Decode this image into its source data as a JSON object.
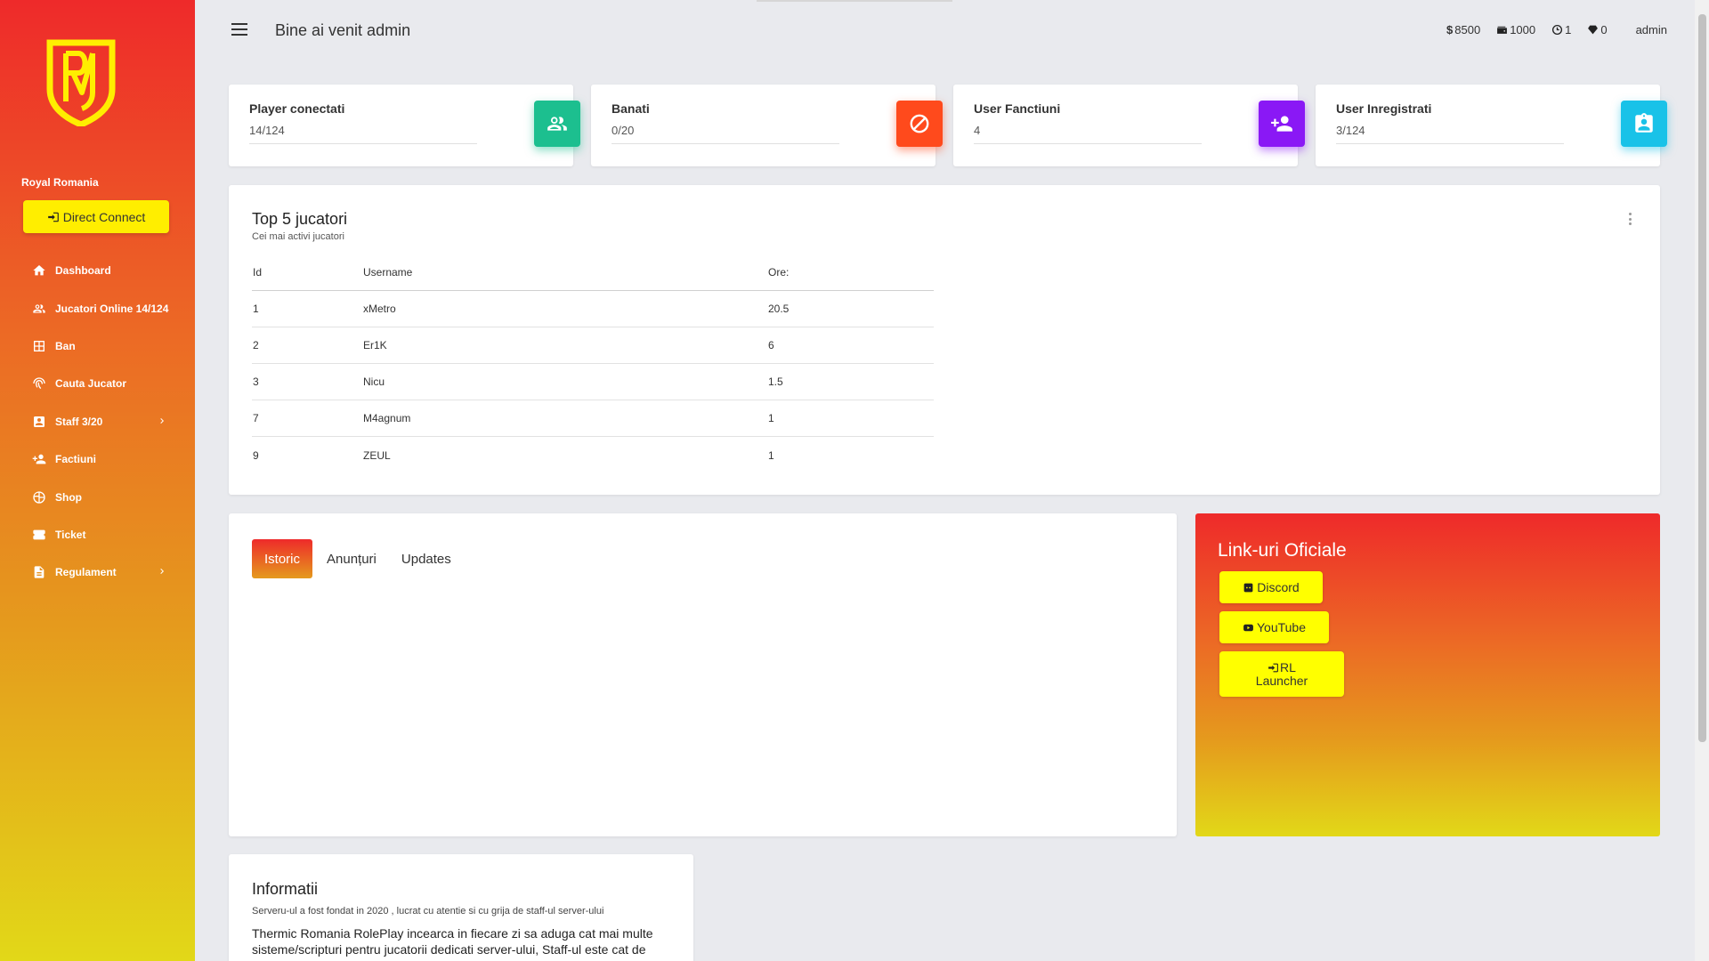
{
  "sidebar": {
    "brand": "Royal Romania",
    "direct_connect": "Direct Connect",
    "items": [
      {
        "label": "Dashboard",
        "icon": "home-icon"
      },
      {
        "label": "Jucatori Online 14/124",
        "icon": "people-icon"
      },
      {
        "label": "Ban",
        "icon": "grid-icon"
      },
      {
        "label": "Cauta Jucator",
        "icon": "fingerprint-icon"
      },
      {
        "label": "Staff 3/20",
        "icon": "badge-icon"
      },
      {
        "label": "Factiuni",
        "icon": "person-add-icon"
      },
      {
        "label": "Shop",
        "icon": "globe-icon"
      },
      {
        "label": "Ticket",
        "icon": "ticket-icon"
      },
      {
        "label": "Regulament",
        "icon": "document-icon"
      }
    ]
  },
  "header": {
    "welcome": "Bine ai venit admin",
    "stats": {
      "money": "8500",
      "cards": "1000",
      "time": "1",
      "diamonds": "0"
    },
    "user": "admin"
  },
  "cards": [
    {
      "title": "Player conectati",
      "value": "14/124",
      "icon": "people-icon",
      "color": "#1cbf8f"
    },
    {
      "title": "Banati",
      "value": "0/20",
      "icon": "block-icon",
      "color": "#ff4a1c"
    },
    {
      "title": "User Fanctiuni",
      "value": "4",
      "icon": "person-add-icon",
      "color": "#8a18f5"
    },
    {
      "title": "User Inregistrati",
      "value": "3/124",
      "icon": "badge-icon",
      "color": "#19c2e8"
    }
  ],
  "top5": {
    "title": "Top 5 jucatori",
    "subtitle": "Cei mai activi jucatori",
    "columns": [
      "Id",
      "Username",
      "Ore:"
    ],
    "rows": [
      [
        "1",
        "xMetro",
        "20.5"
      ],
      [
        "2",
        "Er1K",
        "6"
      ],
      [
        "3",
        "Nicu",
        "1.5"
      ],
      [
        "7",
        "M4agnum",
        "1"
      ],
      [
        "9",
        "ZEUL",
        "1"
      ]
    ]
  },
  "tabs": [
    "Istoric",
    "Anunțuri",
    "Updates"
  ],
  "links": {
    "title": "Link-uri Oficiale",
    "discord": "Discord",
    "youtube": "YouTube",
    "launcher_1": "RL",
    "launcher_2": "Launcher"
  },
  "info": {
    "title": "Informatii",
    "subtitle": "Serveru-ul a fost fondat in 2020 , lucrat cu atentie si cu grija de staff-ul server-ului",
    "body": "Thermic Romania RolePlay incearca in fiecare zi sa aduga cat mai multe sisteme/scripturi pentru jucatorii dedicati server-ului, Staff-ul este cat de"
  },
  "colors": {
    "accent_yellow": "#ffee00",
    "gradient_top": "#ee2a2a",
    "gradient_bottom": "#e2d818"
  }
}
